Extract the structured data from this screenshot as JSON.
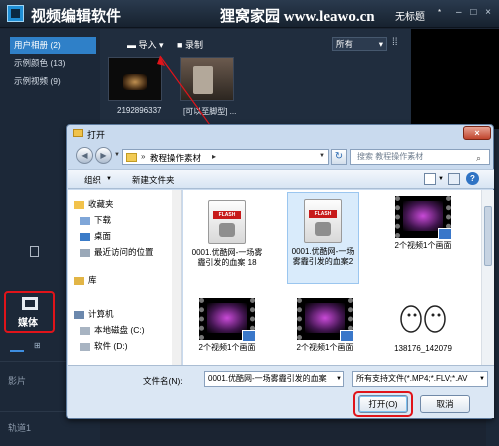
{
  "app": {
    "title": "视频编辑软件",
    "watermark": "狸窝家园 www.leawo.cn",
    "doc_title": "无标题",
    "doc_title_arrow": "*",
    "window_buttons": "– □ ×"
  },
  "sidebar": {
    "items": [
      {
        "label": "用户相册 (2)",
        "active": true
      },
      {
        "label": "示例颜色 (13)",
        "active": false
      },
      {
        "label": "示例视频 (9)",
        "active": false
      }
    ],
    "media_label": "媒体",
    "view_list_icon": "list-view-icon",
    "view_grid_icon": "⊞",
    "tracks": [
      "影片",
      "轨道1"
    ]
  },
  "library": {
    "import_label": "导入",
    "import_arrow": "▾",
    "record_label": "录制",
    "filter_value": "所有",
    "filter_arrow": "▾",
    "grid_icon": "⁞⁞",
    "thumbnails": [
      {
        "label": "2192896337"
      },
      {
        "label": "[可以至脚型] ..."
      }
    ]
  },
  "dialog": {
    "title": "打开",
    "close_label": "×",
    "back_label": "◀",
    "forward_label": "▶",
    "nav_drop": "▼",
    "address_sep": "»",
    "address_path": "教程操作素材",
    "address_sep2": "▸",
    "address_drop": "▼",
    "refresh_label": "↻",
    "search_placeholder": "搜索 教程操作素材",
    "search_icon": "⌕",
    "organize_label": "组织",
    "organize_arrow": "▼",
    "new_folder_label": "新建文件夹",
    "view_arrow": "▼",
    "help_label": "?",
    "nav_items": [
      "收藏夹",
      "下载",
      "桌面",
      "最近访问的位置",
      "库",
      "计算机",
      "本地磁盘 (C:)",
      "软件 (D:)"
    ],
    "files": [
      {
        "name": "0001.优酷网-一场雾霾引发的血案 18",
        "type": "flash"
      },
      {
        "name": "0001.优酷网-一场雾霾引发的血案2",
        "type": "flash"
      },
      {
        "name": "2个视频1个画面",
        "type": "video"
      },
      {
        "name": "2个视频1个画面",
        "type": "video"
      },
      {
        "name": "2个视频1个画面",
        "type": "video"
      },
      {
        "name": "138176_142079",
        "type": "hand"
      }
    ],
    "filename_label": "文件名(N):",
    "filename_value": "0001.优酷网-一场雾霾引发的血案",
    "filetype_value": "所有支持文件(*.MP4;*.FLV;*.AV",
    "dropdown_arrow": "▼",
    "open_label": "打开(O)",
    "cancel_label": "取消"
  },
  "colors": {
    "accent": "#2f80c8",
    "highlight": "#e0141a"
  }
}
